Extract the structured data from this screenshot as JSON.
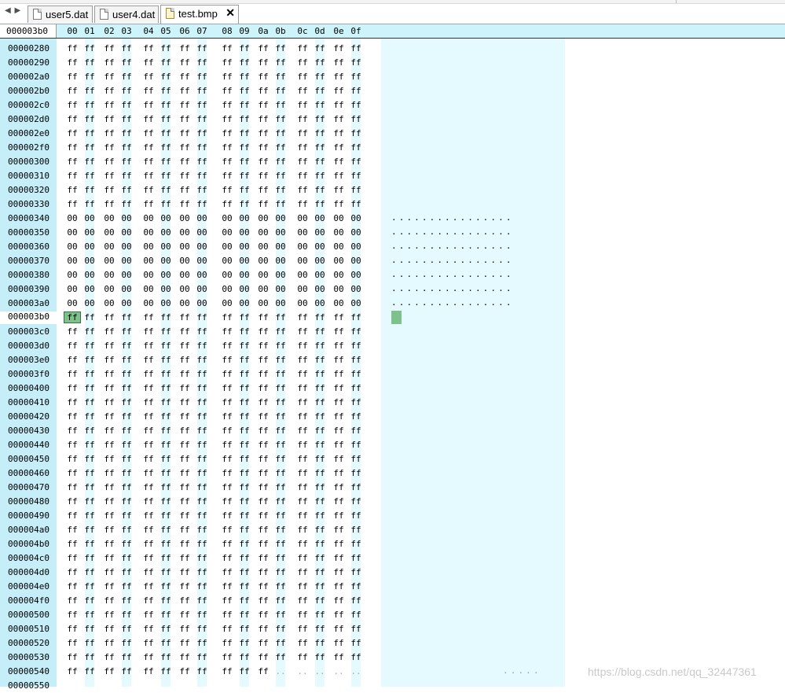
{
  "tabs": [
    {
      "label": "user5.dat",
      "icon": "file-icon"
    },
    {
      "label": "user4.dat",
      "icon": "file-icon"
    },
    {
      "label": "test.bmp",
      "icon": "image-file-icon",
      "active": true
    }
  ],
  "nav_arrows": "◀ ▶",
  "close_glyph": "✕",
  "header": {
    "current_offset": "000003b0",
    "columns": [
      "00",
      "01",
      "02",
      "03",
      "04",
      "05",
      "06",
      "07",
      "08",
      "09",
      "0a",
      "0b",
      "0c",
      "0d",
      "0e",
      "0f"
    ]
  },
  "selected": {
    "offset": "000003b0",
    "column": 0
  },
  "rows": [
    {
      "offset": "00000280",
      "byte": "ff"
    },
    {
      "offset": "00000290",
      "byte": "ff"
    },
    {
      "offset": "000002a0",
      "byte": "ff"
    },
    {
      "offset": "000002b0",
      "byte": "ff"
    },
    {
      "offset": "000002c0",
      "byte": "ff"
    },
    {
      "offset": "000002d0",
      "byte": "ff"
    },
    {
      "offset": "000002e0",
      "byte": "ff"
    },
    {
      "offset": "000002f0",
      "byte": "ff"
    },
    {
      "offset": "00000300",
      "byte": "ff"
    },
    {
      "offset": "00000310",
      "byte": "ff"
    },
    {
      "offset": "00000320",
      "byte": "ff"
    },
    {
      "offset": "00000330",
      "byte": "ff"
    },
    {
      "offset": "00000340",
      "byte": "00",
      "ascii": "................"
    },
    {
      "offset": "00000350",
      "byte": "00",
      "ascii": "................"
    },
    {
      "offset": "00000360",
      "byte": "00",
      "ascii": "................"
    },
    {
      "offset": "00000370",
      "byte": "00",
      "ascii": "................"
    },
    {
      "offset": "00000380",
      "byte": "00",
      "ascii": "................"
    },
    {
      "offset": "00000390",
      "byte": "00",
      "ascii": "................"
    },
    {
      "offset": "000003a0",
      "byte": "00",
      "ascii": "................"
    },
    {
      "offset": "000003b0",
      "byte": "ff"
    },
    {
      "offset": "000003c0",
      "byte": "ff"
    },
    {
      "offset": "000003d0",
      "byte": "ff"
    },
    {
      "offset": "000003e0",
      "byte": "ff"
    },
    {
      "offset": "000003f0",
      "byte": "ff"
    },
    {
      "offset": "00000400",
      "byte": "ff"
    },
    {
      "offset": "00000410",
      "byte": "ff"
    },
    {
      "offset": "00000420",
      "byte": "ff"
    },
    {
      "offset": "00000430",
      "byte": "ff"
    },
    {
      "offset": "00000440",
      "byte": "ff"
    },
    {
      "offset": "00000450",
      "byte": "ff"
    },
    {
      "offset": "00000460",
      "byte": "ff"
    },
    {
      "offset": "00000470",
      "byte": "ff"
    },
    {
      "offset": "00000480",
      "byte": "ff"
    },
    {
      "offset": "00000490",
      "byte": "ff"
    },
    {
      "offset": "000004a0",
      "byte": "ff"
    },
    {
      "offset": "000004b0",
      "byte": "ff"
    },
    {
      "offset": "000004c0",
      "byte": "ff"
    },
    {
      "offset": "000004d0",
      "byte": "ff"
    },
    {
      "offset": "000004e0",
      "byte": "ff"
    },
    {
      "offset": "000004f0",
      "byte": "ff"
    },
    {
      "offset": "00000500",
      "byte": "ff"
    },
    {
      "offset": "00000510",
      "byte": "ff"
    },
    {
      "offset": "00000520",
      "byte": "ff"
    },
    {
      "offset": "00000530",
      "byte": "ff"
    },
    {
      "offset": "00000540",
      "byte": "ff",
      "partial": 11,
      "ascii": "....."
    },
    {
      "offset": "00000550",
      "byte": ""
    }
  ],
  "watermark": "https://blog.csdn.net/qq_32447361",
  "colors": {
    "gutter": "#c6eef9",
    "header": "#cef4fb",
    "ascii_panel": "#e4faff",
    "selection": "#7dc28a"
  }
}
